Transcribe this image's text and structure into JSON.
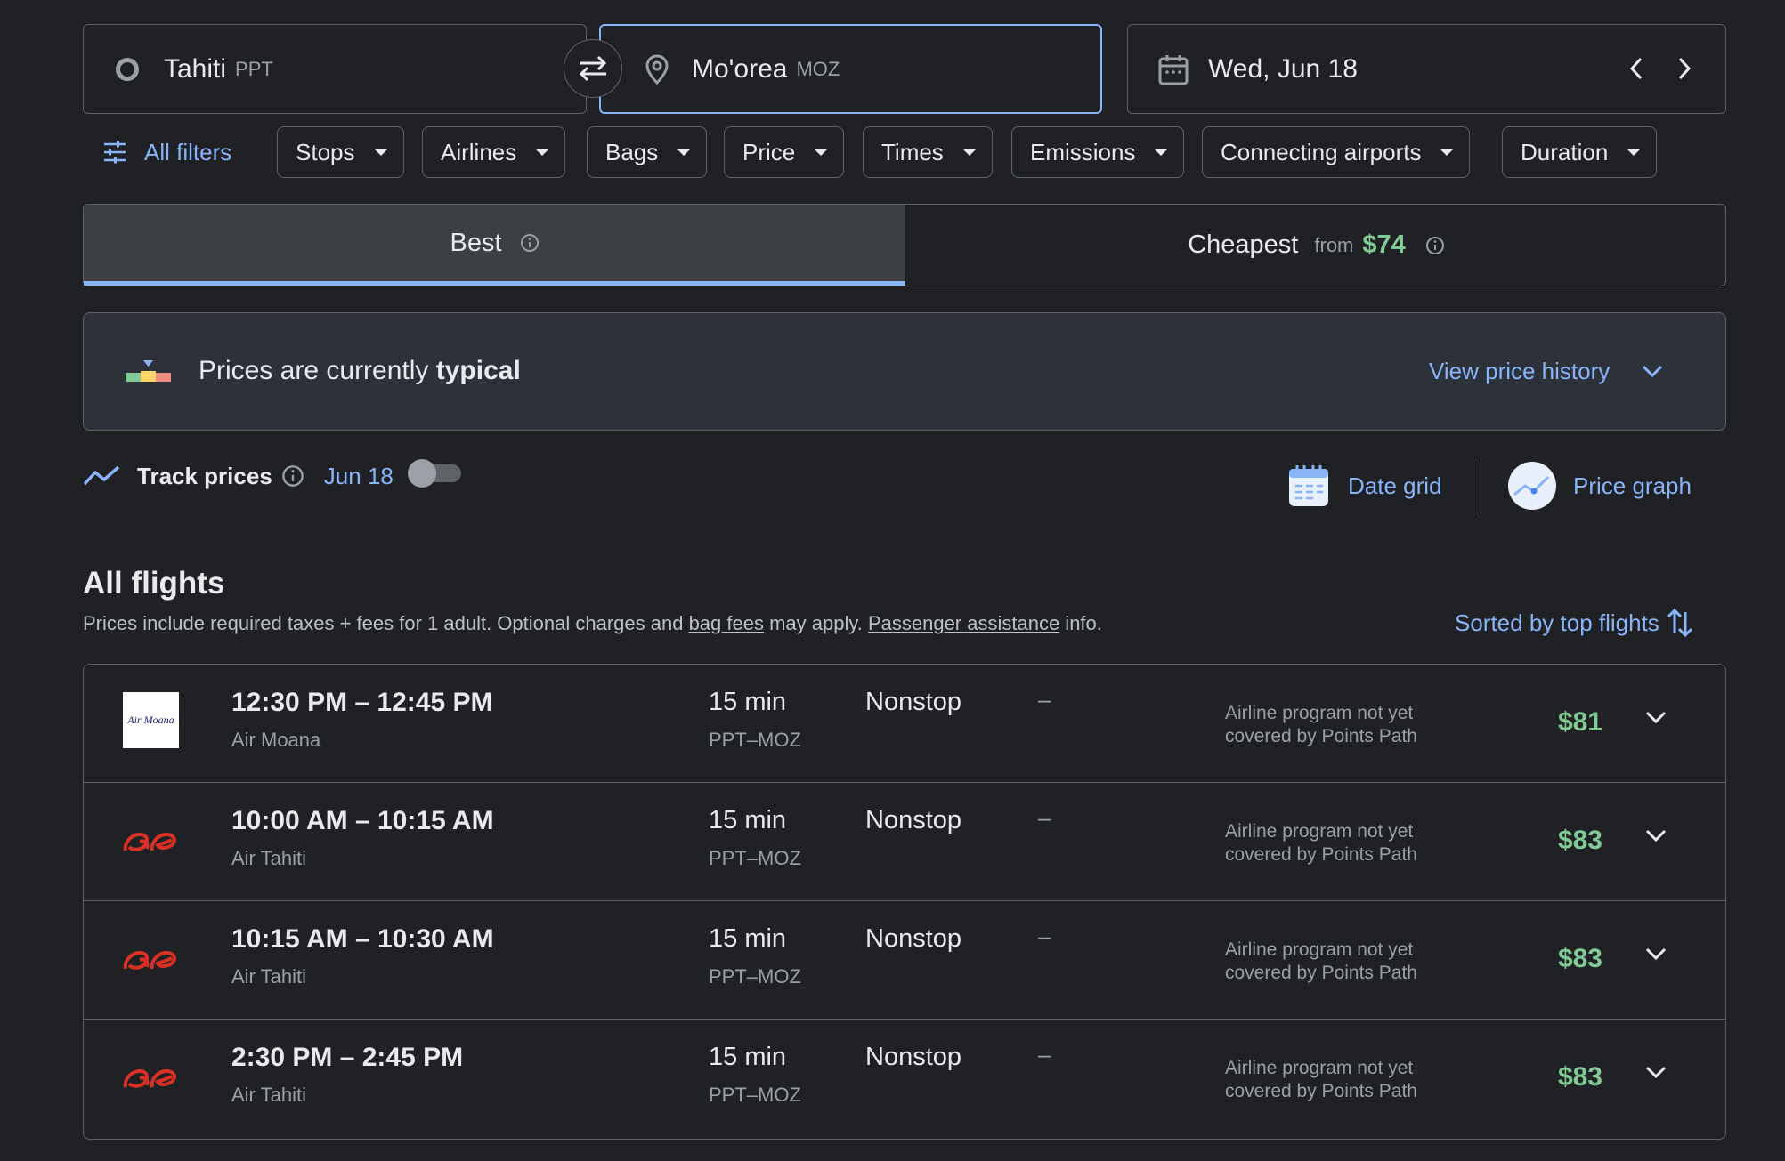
{
  "search": {
    "origin_city": "Tahiti",
    "origin_code": "PPT",
    "destination_city": "Mo'orea",
    "destination_code": "MOZ",
    "date": "Wed, Jun 18"
  },
  "filters": {
    "all_filters_label": "All filters",
    "chips": [
      "Stops",
      "Airlines",
      "Bags",
      "Price",
      "Times",
      "Emissions",
      "Connecting airports",
      "Duration"
    ]
  },
  "tabs": {
    "best_label": "Best",
    "cheapest_label": "Cheapest",
    "cheapest_from": "from",
    "cheapest_price": "$74"
  },
  "insight": {
    "text_prefix": "Prices are currently ",
    "text_level": "typical",
    "history_link": "View price history"
  },
  "tracking": {
    "label": "Track prices",
    "date": "Jun 18",
    "enabled": false,
    "date_grid_label": "Date grid",
    "price_graph_label": "Price graph"
  },
  "results": {
    "heading": "All flights",
    "note_prefix": "Prices include required taxes + fees for 1 adult. Optional charges and ",
    "note_link1": "bag fees",
    "note_mid": " may apply. ",
    "note_link2": "Passenger assistance",
    "note_suffix": " info.",
    "sort_label": "Sorted by top flights"
  },
  "flights": [
    {
      "time": "12:30 PM – 12:45 PM",
      "airline": "Air Moana",
      "logo_text": "Air Moana",
      "duration": "15 min",
      "route": "PPT–MOZ",
      "stops": "Nonstop",
      "emissions": "–",
      "program_line1": "Airline program not yet",
      "program_line2": "covered by Points Path",
      "price": "$81"
    },
    {
      "time": "10:00 AM – 10:15 AM",
      "airline": "Air Tahiti",
      "duration": "15 min",
      "route": "PPT–MOZ",
      "stops": "Nonstop",
      "emissions": "–",
      "program_line1": "Airline program not yet",
      "program_line2": "covered by Points Path",
      "price": "$83"
    },
    {
      "time": "10:15 AM – 10:30 AM",
      "airline": "Air Tahiti",
      "duration": "15 min",
      "route": "PPT–MOZ",
      "stops": "Nonstop",
      "emissions": "–",
      "program_line1": "Airline program not yet",
      "program_line2": "covered by Points Path",
      "price": "$83"
    },
    {
      "time": "2:30 PM – 2:45 PM",
      "airline": "Air Tahiti",
      "duration": "15 min",
      "route": "PPT–MOZ",
      "stops": "Nonstop",
      "emissions": "–",
      "program_line1": "Airline program not yet",
      "program_line2": "covered by Points Path",
      "price": "$83"
    }
  ],
  "colors": {
    "background": "#202124",
    "accent": "#8ab4f8",
    "price_green": "#81c995",
    "border": "#5f6368"
  }
}
